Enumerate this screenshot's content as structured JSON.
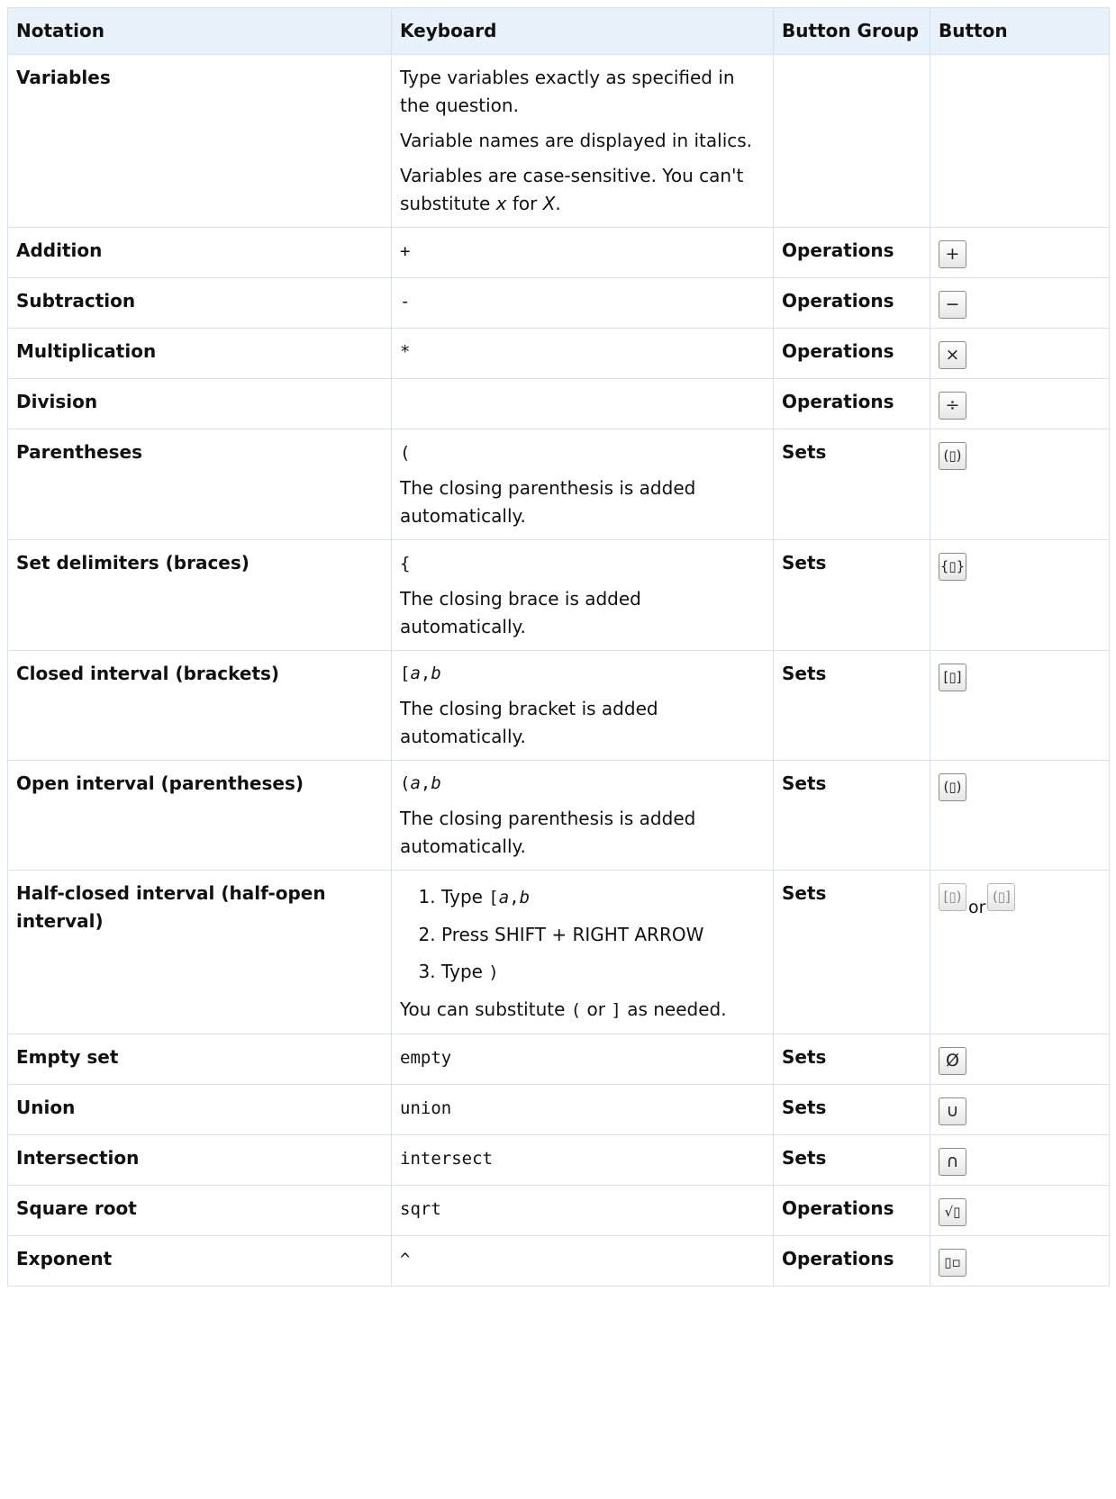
{
  "headers": {
    "notation": "Notation",
    "keyboard": "Keyboard",
    "group": "Button Group",
    "button": "Button"
  },
  "rows": {
    "variables": {
      "notation": "Variables",
      "p1": "Type variables exactly as specified in the question.",
      "p2": "Variable names are displayed in italics.",
      "p3_a": "Variables are case-sensitive. You can't substitute ",
      "p3_x": "x",
      "p3_b": " for ",
      "p3_X": "X",
      "p3_c": "."
    },
    "addition": {
      "notation": "Addition",
      "key": "+",
      "group": "Operations",
      "button": "+"
    },
    "subtraction": {
      "notation": "Subtraction",
      "key": "-",
      "group": "Operations",
      "button": "−"
    },
    "multiplication": {
      "notation": "Multiplication",
      "key": "*",
      "group": "Operations",
      "button": "×"
    },
    "division": {
      "notation": "Division",
      "group": "Operations",
      "button": "÷"
    },
    "parentheses": {
      "notation": "Parentheses",
      "key": "(",
      "note": "The closing parenthesis is added automatically.",
      "group": "Sets",
      "button": "(▯)"
    },
    "braces": {
      "notation": "Set delimiters (braces)",
      "key": "{",
      "note": "The closing brace is added automatically.",
      "group": "Sets",
      "button": "{▯}"
    },
    "closed": {
      "notation": "Closed interval (brackets)",
      "key_a": "[",
      "key_var_a": "a",
      "key_comma": ",",
      "key_var_b": "b",
      "note": "The closing bracket is added automatically.",
      "group": "Sets",
      "button": "[▯]"
    },
    "open": {
      "notation": "Open interval (parentheses)",
      "key_a": "(",
      "key_var_a": "a",
      "key_comma": ",",
      "key_var_b": "b",
      "note": "The closing parenthesis is added automatically.",
      "group": "Sets",
      "button": "(▯)"
    },
    "halfclosed": {
      "notation": "Half-closed interval (half-open interval)",
      "step1_a": "Type ",
      "step1_mono": "[",
      "step1_var_a": "a",
      "step1_comma": ",",
      "step1_var_b": "b",
      "step2": "Press SHIFT + RIGHT ARROW",
      "step3_a": "Type ",
      "step3_mono": ")",
      "note_a": "You can substitute ",
      "note_mono1": "(",
      "note_or": " or ",
      "note_mono2": "]",
      "note_b": " as needed.",
      "group": "Sets",
      "button1": "[▯)",
      "or": "or",
      "button2": "(▯]"
    },
    "empty": {
      "notation": "Empty set",
      "key": "empty",
      "group": "Sets",
      "button": "Ø"
    },
    "union": {
      "notation": "Union",
      "key": "union",
      "group": "Sets",
      "button": "∪"
    },
    "intersection": {
      "notation": "Intersection",
      "key": "intersect",
      "group": "Sets",
      "button": "∩"
    },
    "sqrt": {
      "notation": "Square root",
      "key": "sqrt",
      "group": "Operations",
      "button": "√▯"
    },
    "exponent": {
      "notation": "Exponent",
      "key": "^",
      "group": "Operations",
      "button": "▯▫"
    }
  }
}
